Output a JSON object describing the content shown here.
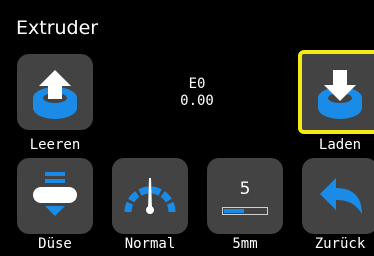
{
  "header": {
    "title": "Extruder"
  },
  "readout": {
    "extruder": "E0",
    "value": "0.00"
  },
  "buttons": {
    "unload": {
      "label": "Leeren",
      "icon": "unload-filament-icon"
    },
    "load": {
      "label": "Laden",
      "icon": "load-filament-icon",
      "selected": true
    },
    "nozzle": {
      "label": "Düse",
      "icon": "nozzle-icon"
    },
    "speed": {
      "label": "Normal",
      "icon": "speedometer-icon"
    },
    "step": {
      "label": "5mm",
      "value": "5",
      "level": 0.5,
      "icon": "step-distance-icon"
    },
    "back": {
      "label": "Zurück",
      "icon": "back-arrow-icon"
    }
  },
  "colors": {
    "accent": "#1a8ce8",
    "tile": "#434343",
    "selection": "#f2ec13",
    "background": "#000000"
  }
}
